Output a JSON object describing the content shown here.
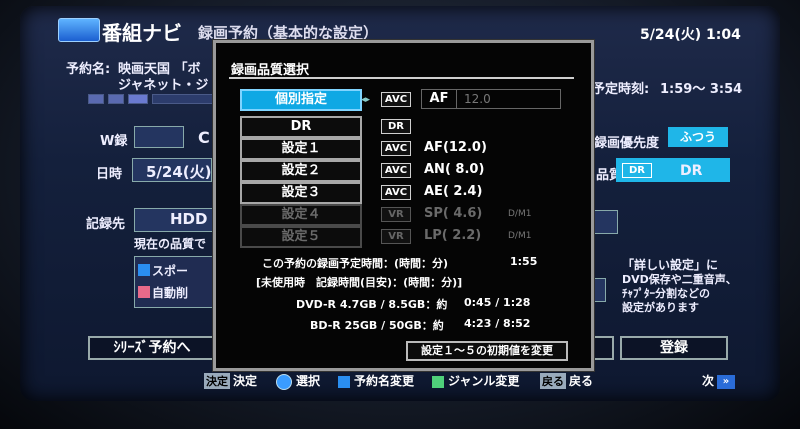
{
  "header": {
    "title": "番組ナビ",
    "subtitle": "録画予約（基本的な設定）",
    "datetime": "5/24(火) 1:04"
  },
  "background": {
    "program_label": "予約名:",
    "program_name_1": "映画天国 「ボ",
    "program_name_2": "ジャネット・ジ",
    "schedule_label": "予定時刻:",
    "schedule_value": "1:59～ 3:54",
    "w_label": "W録",
    "c_label": "C",
    "date_label": "日時",
    "date_value": "5/24(火)",
    "rec_priority_label": "録画優先度",
    "rec_priority_value": "ふつう",
    "quality_label": "品質",
    "quality_tag": "DR",
    "quality_value": "DR",
    "dest_label": "記録先",
    "dest_value": "HDD",
    "current_quality_text": "現在の品質で",
    "sports_label": "スポー",
    "auto_delete_label": "自動削",
    "help_text_1": "「詳しい設定」に",
    "help_text_2": "DVD保存や二重音声、",
    "help_text_3": "ﾁｬﾌﾟﾀｰ分割などの",
    "help_text_4": "設定があります",
    "series_button": "ｼﾘｰｽﾞ予約へ",
    "register_button": "登録"
  },
  "dialog": {
    "title": "録画品質選択",
    "options": [
      {
        "label": "個別指定",
        "tag": "AVC",
        "mode": "",
        "dm": ""
      },
      {
        "label": "DR",
        "tag": "DR",
        "mode": "",
        "dm": ""
      },
      {
        "label": "設定１",
        "tag": "AVC",
        "mode": "AF(12.0)",
        "dm": ""
      },
      {
        "label": "設定２",
        "tag": "AVC",
        "mode": "AN( 8.0)",
        "dm": ""
      },
      {
        "label": "設定３",
        "tag": "AVC",
        "mode": "AE( 2.4)",
        "dm": ""
      },
      {
        "label": "設定４",
        "tag": "VR",
        "mode": "SP( 4.6)",
        "dm": "D/M1"
      },
      {
        "label": "設定５",
        "tag": "VR",
        "mode": "LP( 2.2)",
        "dm": "D/M1"
      }
    ],
    "individual": {
      "mode": "AF",
      "value": "12.0"
    },
    "rec_time_label": "この予約の録画予定時間：(時間：分)",
    "rec_time_value": "1:55",
    "unused_label": "[未使用時　記録時間(目安)：(時間：分)]",
    "dvd_label": "DVD-R 4.7GB / 8.5GB：約",
    "dvd_value": "0:45 / 1:28",
    "bd_label": "BD-R 25GB / 50GB：約",
    "bd_value": "4:23 / 8:52",
    "reset_button": "設定１～５の初期値を変更"
  },
  "footer": {
    "decide_key": "決定",
    "decide_label": "決定",
    "select_label": "選択",
    "rename_label": "予約名変更",
    "genre_label": "ジャンル変更",
    "back_key": "戻る",
    "back_label": "戻る",
    "next_label": "次"
  }
}
